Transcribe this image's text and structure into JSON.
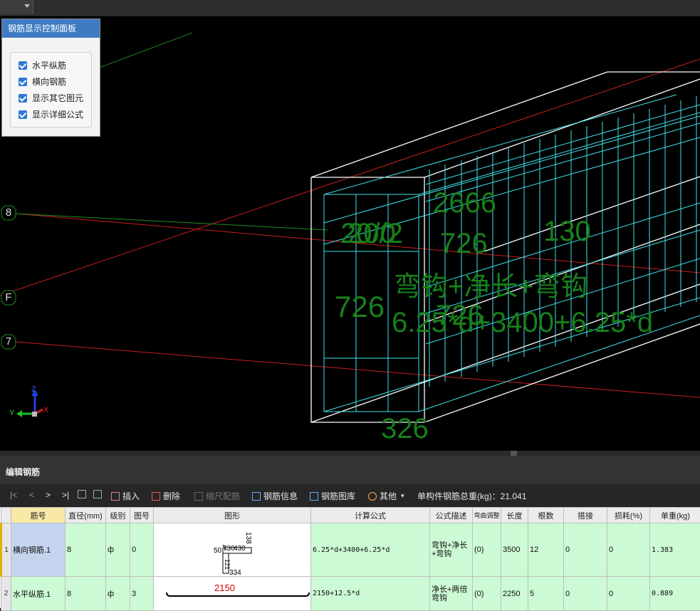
{
  "panel": {
    "title": "钢筋显示控制面板",
    "options": [
      {
        "label": "水平纵筋",
        "checked": true
      },
      {
        "label": "横向钢筋",
        "checked": true
      },
      {
        "label": "显示其它图元",
        "checked": true
      },
      {
        "label": "显示详细公式",
        "checked": true
      }
    ]
  },
  "axis_labels": [
    "8",
    "F",
    "7"
  ],
  "gizmo": {
    "z": "Z",
    "y": "Y",
    "x": "X"
  },
  "overlay_texts": {
    "t1": "20/0",
    "t2": "20/2",
    "t3": "2666",
    "t4": "726",
    "t5": "130",
    "t6": "726",
    "t7": "弯钩+净长+弯钩",
    "t8": "6.25*d+3400+6.25*d",
    "t9": "726",
    "t10": "326"
  },
  "colors": {
    "rebar": "#3de3ea",
    "concrete": "#ffffff",
    "annotation": "#17801a",
    "axis_red": "#cc1f1f",
    "axis_green": "#1f8c1f",
    "row_bg": "#ccfad4"
  },
  "edit_panel": {
    "title": "编辑钢筋"
  },
  "toolbar": {
    "first": "|<",
    "prev": "<",
    "next": ">",
    "last": ">|",
    "insert": "插入",
    "delete": "删除",
    "scale_rebar": "缩尺配筋",
    "rebar_info": "钢筋信息",
    "rebar_library": "钢筋图库",
    "other": "其他",
    "total_weight": "单构件钢筋总重(kg)：21.041"
  },
  "table": {
    "headers": [
      "筋号",
      "直径(mm)",
      "级别",
      "图号",
      "图形",
      "计算公式",
      "公式描述",
      "弯曲调整",
      "长度",
      "根数",
      "搭接",
      "损耗(%)",
      "单重(kg)"
    ],
    "rows": [
      {
        "index": "1",
        "name": "横向钢筋.1",
        "diameter": "8",
        "grade": "ф",
        "fig": "0",
        "shape_labels": {
          "top": "138",
          "a": "50",
          "b": "730",
          "c": "430",
          "d": "121",
          "e": "334"
        },
        "formula": "6.25*d+3400+6.25*d",
        "desc": "弯钩+净长+弯钩",
        "bend": "(0)",
        "length": "3500",
        "count": "12",
        "lap": "0",
        "loss": "0",
        "weight": "1.383"
      },
      {
        "index": "2",
        "name": "水平纵筋.1",
        "diameter": "8",
        "grade": "ф",
        "fig": "3",
        "shape_labels": {
          "value": "2150"
        },
        "formula": "2150+12.5*d",
        "desc": "净长+两倍弯钩",
        "bend": "(0)",
        "length": "2250",
        "count": "5",
        "lap": "0",
        "loss": "0",
        "weight": "0.889"
      }
    ]
  }
}
